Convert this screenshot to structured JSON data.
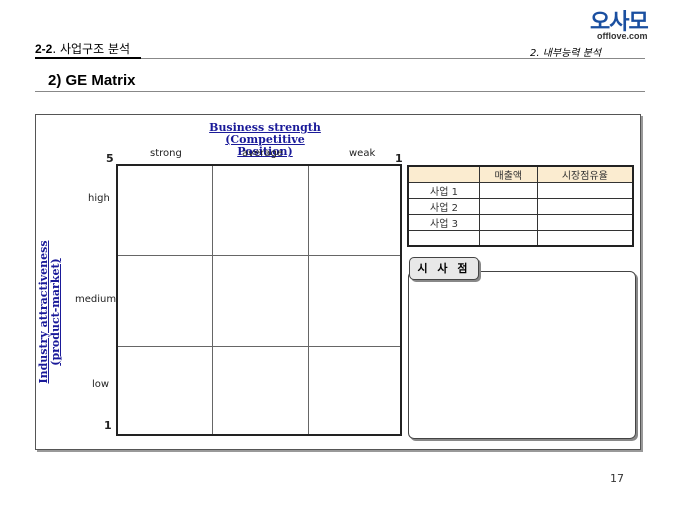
{
  "logo": {
    "text": "오사모",
    "sub": "offlove.com"
  },
  "header": {
    "section_num": "2-2",
    "section_title": ". 사업구조 분석",
    "chapter": "2. 내부능력 분석"
  },
  "title": "2) GE Matrix",
  "matrix": {
    "x_axis_title_1": "Business strength",
    "x_axis_title_2": "(Competitive Position)",
    "x_labels": [
      "strong",
      "average",
      "weak"
    ],
    "x_max": "5",
    "x_min": "1",
    "y_axis_title_1": "Industry attractiveness",
    "y_axis_title_2": "(product-market)",
    "y_labels": [
      "high",
      "medium",
      "low"
    ],
    "y_min": "1"
  },
  "table": {
    "headers": [
      "",
      "매출액",
      "시장점유율"
    ],
    "rows": [
      [
        "사업 1",
        "",
        ""
      ],
      [
        "사업 2",
        "",
        ""
      ],
      [
        "사업 3",
        "",
        ""
      ],
      [
        "",
        "",
        ""
      ]
    ]
  },
  "implications": {
    "label": "시 사 점"
  },
  "page_number": "17"
}
